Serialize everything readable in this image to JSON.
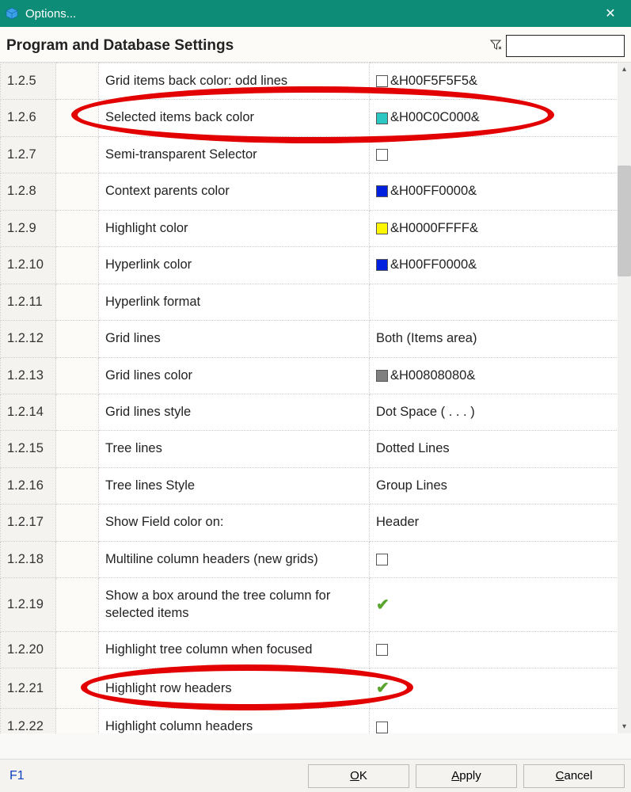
{
  "window": {
    "title": "Options...",
    "close_glyph": "✕"
  },
  "header": {
    "heading": "Program and Database Settings",
    "filter_glyph": "⅄",
    "search_value": ""
  },
  "rows": [
    {
      "id": "1.2.5",
      "label": "Grid items back color: odd lines",
      "value_type": "color",
      "swatch": "#ffffff",
      "value_text": "&H00F5F5F5&"
    },
    {
      "id": "1.2.6",
      "label": "Selected items back color",
      "value_type": "color",
      "swatch": "#2bc8c3",
      "value_text": "&H00C0C000&"
    },
    {
      "id": "1.2.7",
      "label": "Semi-transparent Selector",
      "value_type": "checkbox",
      "checked": false
    },
    {
      "id": "1.2.8",
      "label": "Context parents color",
      "value_type": "color",
      "swatch": "#0020e0",
      "value_text": "&H00FF0000&"
    },
    {
      "id": "1.2.9",
      "label": "Highlight color",
      "value_type": "color",
      "swatch": "#fff700",
      "value_text": "&H0000FFFF&"
    },
    {
      "id": "1.2.10",
      "label": "Hyperlink color",
      "value_type": "color",
      "swatch": "#0020e0",
      "value_text": "&H00FF0000&"
    },
    {
      "id": "1.2.11",
      "label": "Hyperlink format",
      "value_type": "text",
      "value_text": ""
    },
    {
      "id": "1.2.12",
      "label": "Grid lines",
      "value_type": "text",
      "value_text": "Both (Items area)"
    },
    {
      "id": "1.2.13",
      "label": "Grid lines color",
      "value_type": "color",
      "swatch": "#808080",
      "value_text": "&H00808080&"
    },
    {
      "id": "1.2.14",
      "label": "Grid lines style",
      "value_type": "text",
      "value_text": "Dot Space ( . . . )"
    },
    {
      "id": "1.2.15",
      "label": "Tree lines",
      "value_type": "text",
      "value_text": "Dotted Lines"
    },
    {
      "id": "1.2.16",
      "label": "Tree lines Style",
      "value_type": "text",
      "value_text": "Group Lines"
    },
    {
      "id": "1.2.17",
      "label": "Show Field color on:",
      "value_type": "text",
      "value_text": "Header"
    },
    {
      "id": "1.2.18",
      "label": "Multiline column headers (new grids)",
      "value_type": "checkbox",
      "checked": false
    },
    {
      "id": "1.2.19",
      "label": "Show a box around the tree column for selected items",
      "value_type": "check",
      "checked": true
    },
    {
      "id": "1.2.20",
      "label": "Highlight tree column when focused",
      "value_type": "checkbox",
      "checked": false
    },
    {
      "id": "1.2.21",
      "label": "Highlight row headers",
      "value_type": "check",
      "checked": true
    },
    {
      "id": "1.2.22",
      "label": "Highlight column headers",
      "value_type": "checkbox",
      "checked": false
    }
  ],
  "footer": {
    "help": "F1",
    "ok": "OK",
    "ok_underline": "O",
    "apply": "Apply",
    "apply_underline": "A",
    "cancel": "Cancel",
    "cancel_underline": "C"
  }
}
